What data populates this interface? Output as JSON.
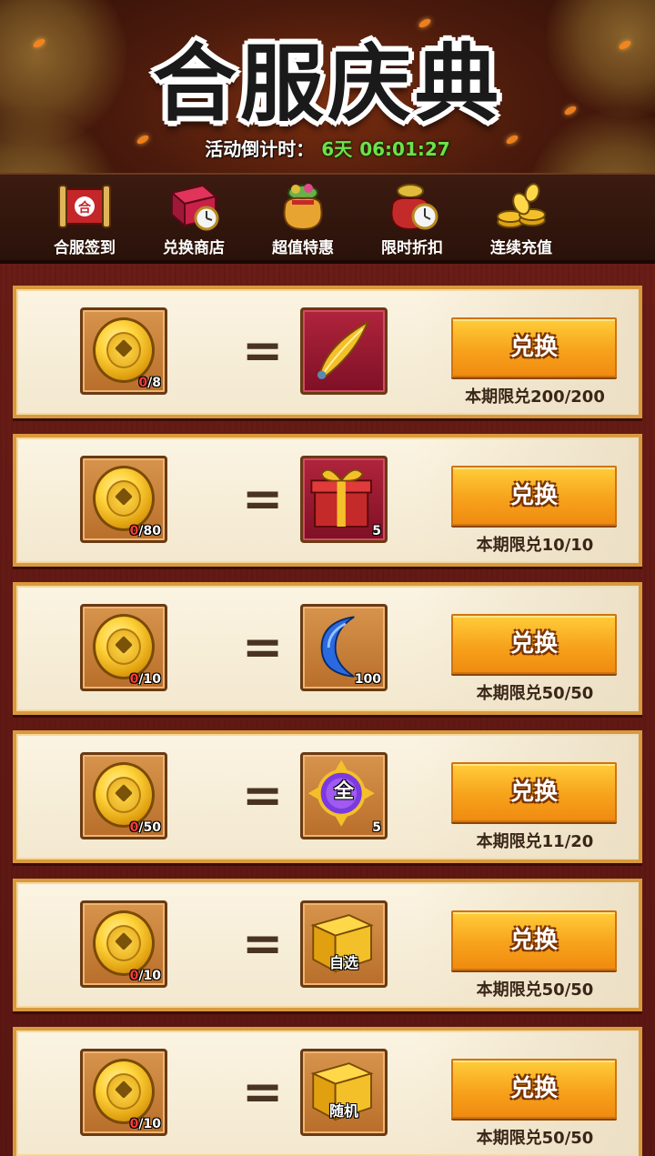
{
  "header": {
    "title": "合服庆典",
    "countdown_label": "活动倒计时：",
    "countdown_days": "6天",
    "countdown_time": "06:01:27"
  },
  "nav": [
    {
      "label": "合服签到",
      "icon": "scroll-icon"
    },
    {
      "label": "兑换商店",
      "icon": "gift-box-clock-icon"
    },
    {
      "label": "超值特惠",
      "icon": "lucky-bag-icon"
    },
    {
      "label": "限时折扣",
      "icon": "bag-clock-icon"
    },
    {
      "label": "连续充值",
      "icon": "gold-coins-icon"
    }
  ],
  "exchange": {
    "button_label": "兑换",
    "equals": "="
  },
  "rows": [
    {
      "cost_have": "0",
      "cost_need": "/8",
      "reward_icon": "golden-feather-icon",
      "reward_qty": "",
      "reward_tag": "",
      "limit": "本期限兑200/200"
    },
    {
      "cost_have": "0",
      "cost_need": "/80",
      "reward_icon": "red-gift-box-icon",
      "reward_qty": "5",
      "reward_tag": "",
      "limit": "本期限兑10/10"
    },
    {
      "cost_have": "0",
      "cost_need": "/10",
      "reward_icon": "blue-crescent-icon",
      "reward_qty": "100",
      "reward_tag": "",
      "limit": "本期限兑50/50"
    },
    {
      "cost_have": "0",
      "cost_need": "/50",
      "reward_icon": "purple-orb-icon",
      "reward_qty": "5",
      "reward_tag": "全",
      "limit": "本期限兑11/20"
    },
    {
      "cost_have": "0",
      "cost_need": "/10",
      "reward_icon": "gold-chest-select-icon",
      "reward_qty": "",
      "reward_tag": "自选",
      "limit": "本期限兑50/50"
    },
    {
      "cost_have": "0",
      "cost_need": "/10",
      "reward_icon": "gold-chest-random-icon",
      "reward_qty": "",
      "reward_tag": "随机",
      "limit": "本期限兑50/50"
    }
  ],
  "colors": {
    "button_orange": "#f7a21c",
    "countdown_green": "#6fe04a",
    "frame_gold": "#d99a3e",
    "list_bg": "#5a1612"
  }
}
